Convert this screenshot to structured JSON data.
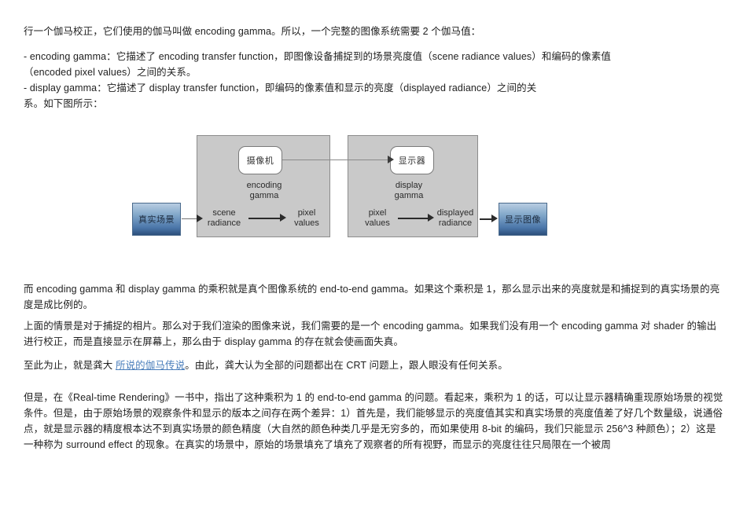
{
  "document": {
    "paragraphs": {
      "intro": "行一个伽马校正，它们使用的伽马叫做 encoding gamma。所以，一个完整的图像系统需要 2 个伽马值：",
      "bullets": "- encoding gamma：它描述了 encoding transfer function，即图像设备捕捉到的场景亮度值（scene radiance values）和编码的像素值（encoded pixel values）之间的关系。\n- display gamma：它描述了 display transfer function，即编码的像素值和显示的亮度（displayed radiance）之间的关",
      "xi": "系。如下图所示：",
      "product": "而 encoding gamma 和 display gamma 的乘积就是真个图像系统的 end-to-end gamma。如果这个乘积是 1，那么显示出来的亮度就是和捕捉到的真实场景的亮度是成比例的。",
      "render": "上面的情景是对于捕捉的相片。那么对于我们渲染的图像来说，我们需要的是一个 encoding gamma。如果我们没有用一个 encoding gamma 对 shader 的输出进行校正，而是直接显示在屏幕上，那么由于 display gamma 的存在就会使画面失真。",
      "crt_prefix": "至此为止，就是龚大 ",
      "crt_link": "所说的伽马传说",
      "crt_suffix": "。由此，龚大认为全部的问题都出在 CRT 问题上，跟人眼没有任何关系。",
      "rtr": "但是，在《Real-time Rendering》一书中，指出了这种乘积为 1 的 end-to-end gamma 的问题。看起来，乘积为 1 的话，可以让显示器精确重现原始场景的视觉条件。但是，由于原始场景的观察条件和显示的版本之间存在两个差异：1）首先是，我们能够显示的亮度值其实和真实场景的亮度值差了好几个数量级，说通俗点，就是显示器的精度根本达不到真实场景的颜色精度（大自然的颜色种类几乎是无穷多的，而如果使用 8-bit 的编码，我们只能显示 256^3 种颜色）；2）这是一种称为 surround effect 的现象。在真实的场景中，原始的场景填充了填充了观察者的所有视野，而显示的亮度往往只局限在一个被周"
    }
  },
  "diagram": {
    "scene_box_label": "真实场景",
    "display_box_label": "显示图像",
    "camera_label": "摄像机",
    "monitor_label": "显示器",
    "encoding_gamma_label": "encoding\ngamma",
    "display_gamma_label": "display\ngamma",
    "scene_radiance_label": "scene\nradiance",
    "pixel_values_label_1": "pixel\nvalues",
    "pixel_values_label_2": "pixel\nvalues",
    "displayed_radiance_label": "displayed\nradiance"
  },
  "colors": {
    "link": "#4a7ebb",
    "gray_box_fill": "#c9c9c9",
    "gray_box_border": "#8c8c8c",
    "blue_box_top": "#b8cde2",
    "blue_box_bottom": "#2c4f7c",
    "text": "#1f1f1f"
  }
}
